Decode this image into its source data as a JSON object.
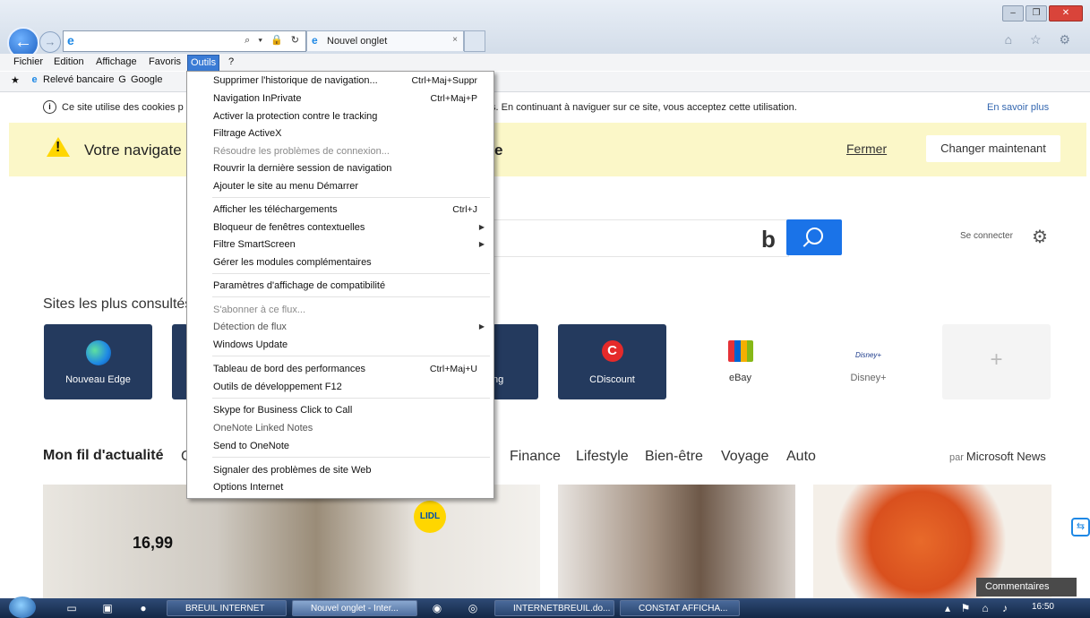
{
  "browser": {
    "tab_label": "Nouvel onglet",
    "tab_close": "×",
    "address_tools": "⌕ ▾ 🔒 ↻",
    "right_icons": "⌂ ☆ ⚙",
    "window_controls": [
      "–",
      "❐",
      "✕"
    ]
  },
  "menubar": [
    "Fichier",
    "Edition",
    "Affichage",
    "Favoris",
    "Outils",
    "?"
  ],
  "favorites": [
    {
      "label": "Relevé bancaire",
      "icon": "e"
    },
    {
      "label": "Google",
      "icon": "G"
    }
  ],
  "cookie_bar": {
    "text_left": "Ce site utilise des cookies p",
    "text_right": "s. En continuant à naviguer sur ce site, vous acceptez cette utilisation.",
    "more": "En savoir plus"
  },
  "warning": {
    "message": "Votre navigate",
    "message_end": "e",
    "close": "Fermer",
    "change": "Changer maintenant"
  },
  "search": {
    "bing": "b",
    "signin": "Se connecter",
    "gear": "⚙"
  },
  "top_sites": {
    "title": "Sites les plus consultés",
    "tiles": [
      {
        "label": "Nouveau Edge"
      },
      {
        "label": "ng"
      },
      {
        "label": "CDiscount"
      },
      {
        "label": "eBay"
      },
      {
        "label": "Disney+"
      },
      {
        "label": "+"
      }
    ]
  },
  "news": {
    "title": "Mon fil d'actualité",
    "cut": "C",
    "categories": [
      "Finance",
      "Lifestyle",
      "Bien-être",
      "Voyage",
      "Auto"
    ],
    "par": "par",
    "source": "Microsoft News",
    "price": "16,99",
    "brand": "LIDL"
  },
  "tools_menu": {
    "items": [
      {
        "label": "Supprimer l'historique de navigation...",
        "shortcut": "Ctrl+Maj+Suppr"
      },
      {
        "label": "Navigation InPrivate",
        "shortcut": "Ctrl+Maj+P"
      },
      {
        "label": "Activer la protection contre le tracking",
        "shortcut": ""
      },
      {
        "label": "Filtrage ActiveX",
        "shortcut": ""
      },
      {
        "label": "Résoudre les problèmes de connexion...",
        "shortcut": ""
      },
      {
        "label": "Rouvrir la dernière session de navigation",
        "shortcut": ""
      },
      {
        "label": "Ajouter le site au menu Démarrer",
        "shortcut": ""
      },
      {
        "label": "Afficher les téléchargements",
        "shortcut": "Ctrl+J"
      },
      {
        "label": "Bloqueur de fenêtres contextuelles",
        "shortcut": ""
      },
      {
        "label": "Filtre SmartScreen",
        "shortcut": ""
      },
      {
        "label": "Gérer les modules complémentaires",
        "shortcut": ""
      },
      {
        "label": "Paramètres d'affichage de compatibilité",
        "shortcut": ""
      },
      {
        "label": "S'abonner à ce flux...",
        "shortcut": ""
      },
      {
        "label": "Détection de flux",
        "shortcut": ""
      },
      {
        "label": "Windows Update",
        "shortcut": ""
      },
      {
        "label": "Tableau de bord des performances",
        "shortcut": "Ctrl+Maj+U"
      },
      {
        "label": "Outils de développement F12",
        "shortcut": ""
      },
      {
        "label": "Skype for Business Click to Call",
        "shortcut": ""
      },
      {
        "label": "OneNote Linked Notes",
        "shortcut": ""
      },
      {
        "label": "Send to OneNote",
        "shortcut": ""
      },
      {
        "label": "Signaler des problèmes de site Web",
        "shortcut": ""
      },
      {
        "label": "Options Internet",
        "shortcut": ""
      }
    ]
  },
  "taskbar": {
    "buttons": [
      "BREUIL INTERNET",
      "Nouvel onglet - Inter...",
      "INTERNETBREUIL.do...",
      "CONSTAT AFFICHA..."
    ],
    "clock": "16:50",
    "comments": "Commentaires"
  },
  "colors": {
    "accent": "#1a73e8",
    "warning_bg": "#fbf7c8",
    "tile_dark": "#243a5e",
    "menu_highlight": "#3a7bd5"
  }
}
